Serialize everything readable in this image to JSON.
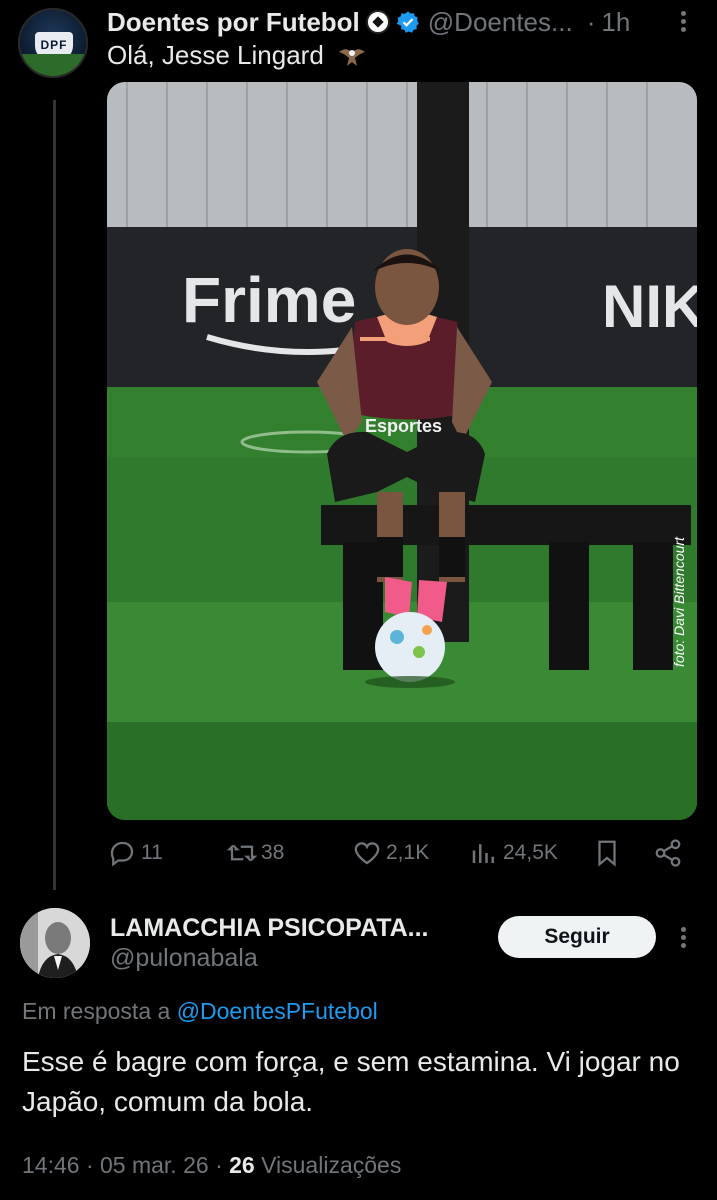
{
  "tweet": {
    "author_name": "Doentes por Futebol",
    "author_handle": "@Doentes...",
    "separator": "·",
    "time": "1h",
    "text": "Olá, Jesse Lingard",
    "avatar_text": "DPF",
    "photo": {
      "banner_text_left": "Frime",
      "banner_text_right": "NIK",
      "shirt_text": "Esportes",
      "credit": "foto: Davi Bittencourt"
    },
    "actions": {
      "replies": "11",
      "retweets": "38",
      "likes": "2,1K",
      "views": "24,5K"
    }
  },
  "reply": {
    "author_name": "LAMACCHIA PSICOPATA...",
    "author_handle": "@pulonabala",
    "follow_label": "Seguir",
    "reply_prefix": "Em resposta a",
    "reply_to": "@DoentesPFutebol",
    "text": "Esse é bagre com força, e sem estamina. Vi jogar no Japão, comum da bola.",
    "timestamp": "14:46 · 05 mar. 26 ·",
    "views_count": "26",
    "views_label": "Visualizações"
  },
  "colors": {
    "background": "#000000",
    "text_primary": "#e7e9ea",
    "text_secondary": "#71767b",
    "accent": "#1d9bf0",
    "verified": "#1d9bf0"
  },
  "icons": [
    "ball-icon",
    "verified-icon",
    "eagle-icon",
    "more-icon",
    "reply-icon",
    "retweet-icon",
    "like-icon",
    "views-icon",
    "bookmark-icon",
    "share-icon"
  ]
}
